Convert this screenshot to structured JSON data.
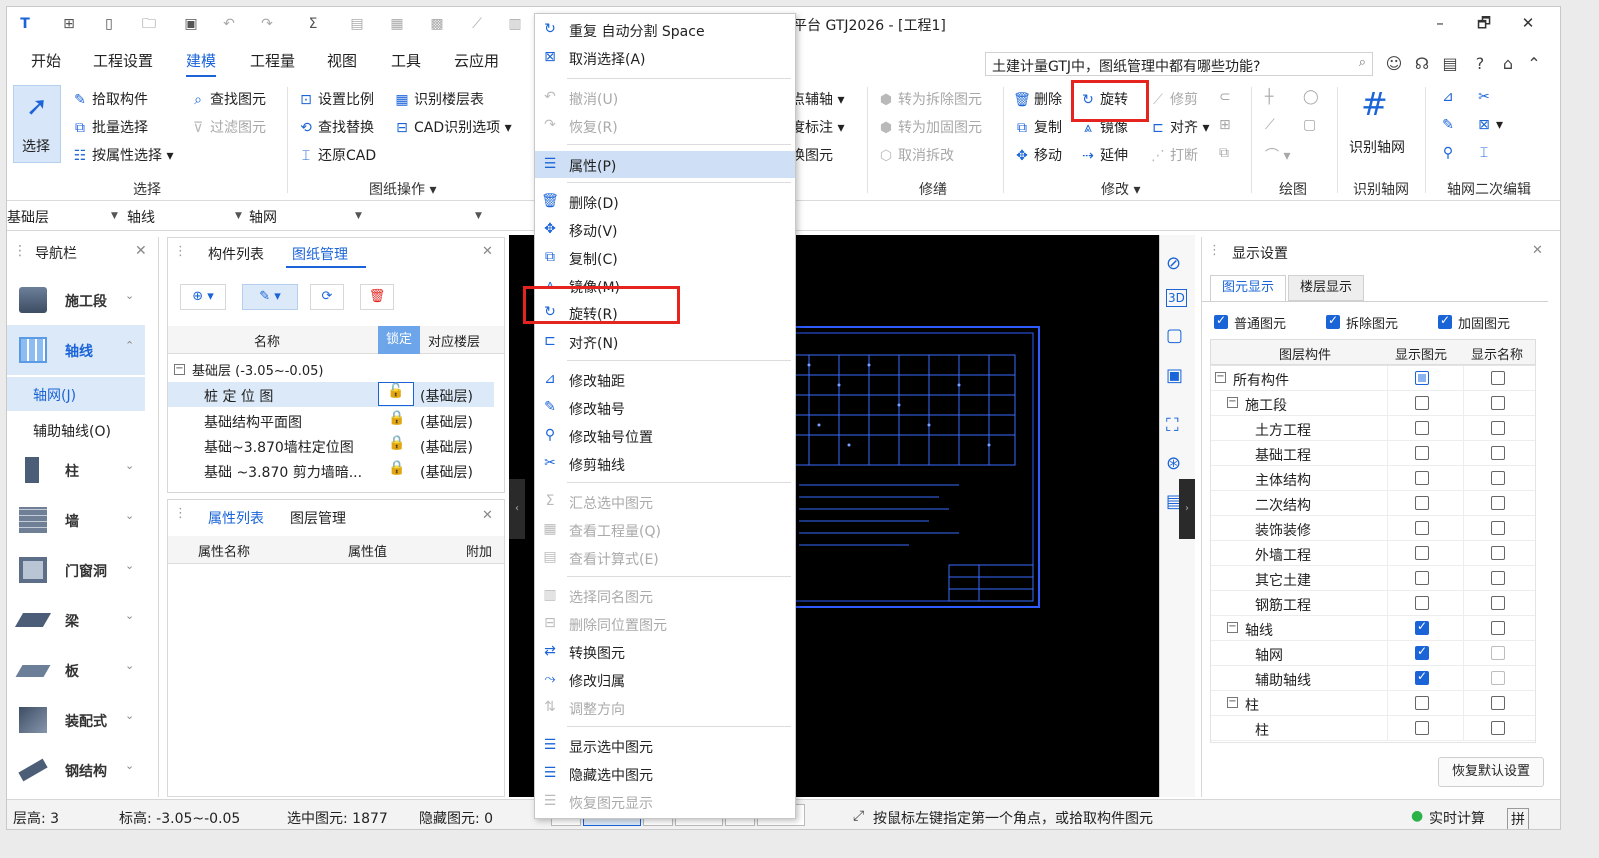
{
  "title_bar": {
    "title": "平台 GTJ2026 - [工程1]",
    "controls": [
      "–",
      "🗗",
      "✕"
    ]
  },
  "menu_tabs": [
    "开始",
    "工程设置",
    "建模",
    "工程量",
    "视图",
    "工具",
    "云应用"
  ],
  "active_tab": "建模",
  "help_search": {
    "text": "土建计量GTJ中，图纸管理中都有哪些功能?"
  },
  "ribbon": {
    "select": {
      "big_label": "选择",
      "items": [
        "拾取构件",
        "批量选择",
        "按属性选择"
      ],
      "group": "选择"
    },
    "find": {
      "items": [
        "查找图元",
        "过滤图元"
      ]
    },
    "drawing_ops": {
      "items": [
        "设置比例",
        "识别楼层表",
        "查找替换",
        "CAD识别选项",
        "还原CAD"
      ],
      "group": "图纸操作"
    },
    "axis_partial": [
      "点辅轴",
      "度标注",
      "换图元"
    ],
    "repair": {
      "items": [
        "转为拆除图元",
        "转为加固图元",
        "取消拆改"
      ],
      "group": "修缮"
    },
    "modify": {
      "items": [
        "删除",
        "旋转",
        "修剪",
        "复制",
        "镜像",
        "对齐",
        "移动",
        "延伸",
        "打断"
      ],
      "group": "修改"
    },
    "draw_group": "绘图",
    "recognize_axis": {
      "label": "识别轴网",
      "group": "识别轴网"
    },
    "axis_secondary_group": "轴网二次编辑"
  },
  "dropdowns": [
    "基础层",
    "轴线",
    "轴网",
    ""
  ],
  "nav_panel": {
    "title": "导航栏",
    "items": [
      "施工段",
      "轴线",
      "柱",
      "墙",
      "门窗洞",
      "梁",
      "板",
      "装配式",
      "钢结构"
    ],
    "sub_items": [
      "轴网(J)",
      "辅助轴线(O)"
    ]
  },
  "drawing_panel": {
    "tabs": [
      "构件列表",
      "图纸管理"
    ],
    "columns": [
      "名称",
      "锁定",
      "对应楼层"
    ],
    "group_row": "基础层 (-3.05~-0.05)",
    "rows": [
      {
        "name": "桩 定 位 图",
        "floor": "(基础层)"
      },
      {
        "name": "基础结构平面图",
        "floor": "(基础层)"
      },
      {
        "name": "基础~3.870墙柱定位图",
        "floor": "(基础层)"
      },
      {
        "name": "基础 ~3.870 剪力墙暗...",
        "floor": "(基础层)"
      }
    ]
  },
  "property_panel": {
    "tabs": [
      "属性列表",
      "图层管理"
    ],
    "columns": [
      "属性名称",
      "属性值",
      "附加"
    ]
  },
  "context_menu": {
    "items": [
      {
        "label": "重复 自动分割  Space",
        "icon": "repeat-icon",
        "enabled": true
      },
      {
        "label": "取消选择(A)",
        "icon": "cancel-select-icon",
        "enabled": true
      },
      {
        "label": "撤消(U)",
        "icon": "undo-icon",
        "enabled": false
      },
      {
        "label": "恢复(R)",
        "icon": "redo-icon",
        "enabled": false
      },
      {
        "label": "属性(P)",
        "icon": "properties-icon",
        "enabled": true,
        "highlighted": true
      },
      {
        "label": "删除(D)",
        "icon": "delete-icon",
        "enabled": true
      },
      {
        "label": "移动(V)",
        "icon": "move-icon",
        "enabled": true
      },
      {
        "label": "复制(C)",
        "icon": "copy-icon",
        "enabled": true
      },
      {
        "label": "镜像(M)",
        "icon": "mirror-icon",
        "enabled": true
      },
      {
        "label": "旋转(R)",
        "icon": "rotate-icon",
        "enabled": true,
        "boxed": true
      },
      {
        "label": "对齐(N)",
        "icon": "align-icon",
        "enabled": true
      },
      {
        "label": "修改轴距",
        "icon": "axis-spacing-icon",
        "enabled": true
      },
      {
        "label": "修改轴号",
        "icon": "axis-number-icon",
        "enabled": true
      },
      {
        "label": "修改轴号位置",
        "icon": "axis-number-position-icon",
        "enabled": true
      },
      {
        "label": "修剪轴线",
        "icon": "trim-axis-icon",
        "enabled": true
      },
      {
        "label": "汇总选中图元",
        "icon": "sum-icon",
        "enabled": false
      },
      {
        "label": "查看工程量(Q)",
        "icon": "quantity-icon",
        "enabled": false
      },
      {
        "label": "查看计算式(E)",
        "icon": "formula-icon",
        "enabled": false
      },
      {
        "label": "选择同名图元",
        "icon": "select-same-name-icon",
        "enabled": false
      },
      {
        "label": "删除同位置图元",
        "icon": "delete-same-position-icon",
        "enabled": false
      },
      {
        "label": "转换图元",
        "icon": "convert-icon",
        "enabled": true
      },
      {
        "label": "修改归属",
        "icon": "ownership-icon",
        "enabled": true
      },
      {
        "label": "调整方向",
        "icon": "direction-icon",
        "enabled": false
      },
      {
        "label": "显示选中图元",
        "icon": "show-selected-icon",
        "enabled": true
      },
      {
        "label": "隐藏选中图元",
        "icon": "hide-selected-icon",
        "enabled": true
      },
      {
        "label": "恢复图元显示",
        "icon": "restore-display-icon",
        "enabled": false
      }
    ]
  },
  "display_panel": {
    "title": "显示设置",
    "tabs": [
      "图元显示",
      "楼层显示"
    ],
    "toggles": [
      {
        "label": "普通图元",
        "checked": true
      },
      {
        "label": "拆除图元",
        "checked": true
      },
      {
        "label": "加固图元",
        "checked": true
      }
    ],
    "columns": [
      "图层构件",
      "显示图元",
      "显示名称"
    ],
    "rows": [
      {
        "label": "所有构件",
        "level": 0,
        "expand": true,
        "show": "partial",
        "name": false
      },
      {
        "label": "施工段",
        "level": 1,
        "expand": true,
        "show": false,
        "name": false
      },
      {
        "label": "土方工程",
        "level": 2,
        "show": false,
        "name": false
      },
      {
        "label": "基础工程",
        "level": 2,
        "show": false,
        "name": false
      },
      {
        "label": "主体结构",
        "level": 2,
        "show": false,
        "name": false
      },
      {
        "label": "二次结构",
        "level": 2,
        "show": false,
        "name": false
      },
      {
        "label": "装饰装修",
        "level": 2,
        "show": false,
        "name": false
      },
      {
        "label": "外墙工程",
        "level": 2,
        "show": false,
        "name": false
      },
      {
        "label": "其它土建",
        "level": 2,
        "show": false,
        "name": false
      },
      {
        "label": "钢筋工程",
        "level": 2,
        "show": false,
        "name": false
      },
      {
        "label": "轴线",
        "level": 1,
        "expand": true,
        "show": true,
        "name": false
      },
      {
        "label": "轴网",
        "level": 2,
        "show": true,
        "name": false,
        "name_dim": true
      },
      {
        "label": "辅助轴线",
        "level": 2,
        "show": true,
        "name": false,
        "name_dim": true
      },
      {
        "label": "柱",
        "level": 1,
        "expand": true,
        "show": false,
        "name": false
      },
      {
        "label": "柱",
        "level": 2,
        "show": false,
        "name": false
      }
    ],
    "restore_button": "恢复默认设置"
  },
  "status_bar": {
    "floor_height": "层高:  3",
    "elevation": "标高:  -3.05~-0.05",
    "selected": "选中图元: 1877",
    "hidden": "隐藏图元: 0",
    "hint": "按鼠标左键指定第一个角点，或拾取构件图元",
    "realtime": "实时计算",
    "ime": "拼"
  },
  "colors": {
    "accent": "#1a64d8",
    "highlight": "#e5231f",
    "canvas": "#000000",
    "cad_lines": "#2f5cff"
  }
}
